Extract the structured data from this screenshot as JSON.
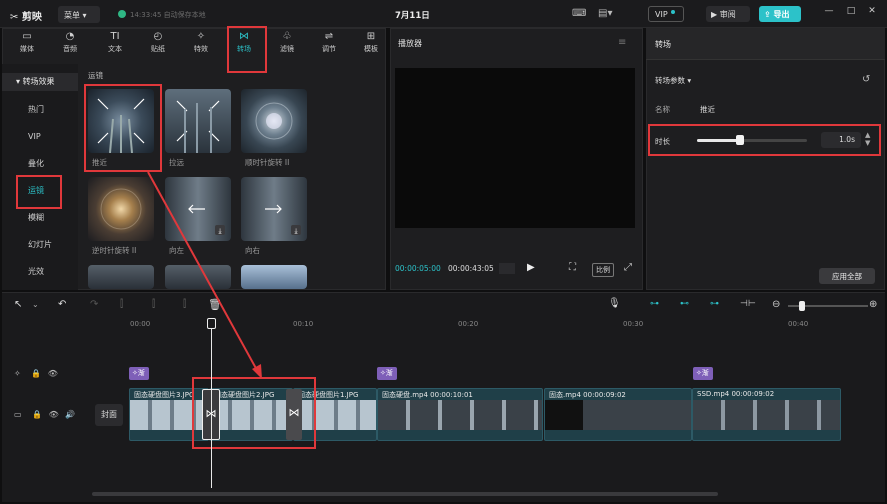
{
  "titlebar": {
    "app_name": "剪映",
    "menu": "菜单",
    "autosave": "14:33:45 自动保存本地",
    "date": "7月11日",
    "vip": "VIP",
    "review": "审阅",
    "export": "导出",
    "minimize": "—",
    "maximize": "□",
    "close": "✕"
  },
  "tools": [
    {
      "label": "媒体",
      "icon": "▭"
    },
    {
      "label": "音频",
      "icon": "◔"
    },
    {
      "label": "文本",
      "icon": "TI"
    },
    {
      "label": "贴纸",
      "icon": "◴"
    },
    {
      "label": "特效",
      "icon": "✧"
    },
    {
      "label": "转场",
      "icon": "⋈"
    },
    {
      "label": "滤镜",
      "icon": "♧"
    },
    {
      "label": "调节",
      "icon": "⇌"
    },
    {
      "label": "模板",
      "icon": "⊞"
    }
  ],
  "sidebar": {
    "header": "转场效果",
    "items": [
      "热门",
      "VIP",
      "叠化",
      "运镜",
      "模糊",
      "幻灯片",
      "光效"
    ]
  },
  "grid": {
    "section": "运镜",
    "items": [
      "推近",
      "拉远",
      "顺时针旋转 II",
      "逆时针旋转 II",
      "向左",
      "向右"
    ]
  },
  "player": {
    "title": "播放器",
    "current": "00:00:05:00",
    "total": "00:00:43:05",
    "ratio": "比例"
  },
  "props": {
    "title": "转场",
    "param_header": "转场参数",
    "name_label": "名称",
    "name_value": "推近",
    "duration_label": "时长",
    "duration_value": "1.0s",
    "duration_fraction": 0.39,
    "apply_all": "应用全部"
  },
  "timeline": {
    "ruler": [
      "00:00",
      "00:10",
      "00:20",
      "00:30",
      "00:40"
    ],
    "cover": "封面",
    "effect_tag": "渐",
    "clips": [
      {
        "label": "固态硬盘图片3.JPG"
      },
      {
        "label": "固态硬盘图片2.JPG"
      },
      {
        "label": "固态硬盘图片1.JPG"
      },
      {
        "label": "固态硬盘.mp4  00:00:10:01"
      },
      {
        "label": "固态.mp4  00:00:09:02"
      },
      {
        "label": "SSD.mp4  00:00:09:02"
      }
    ]
  },
  "colors": {
    "accent": "#2cc2c9",
    "highlight": "#e0383b",
    "effect": "#7e5fb8"
  }
}
